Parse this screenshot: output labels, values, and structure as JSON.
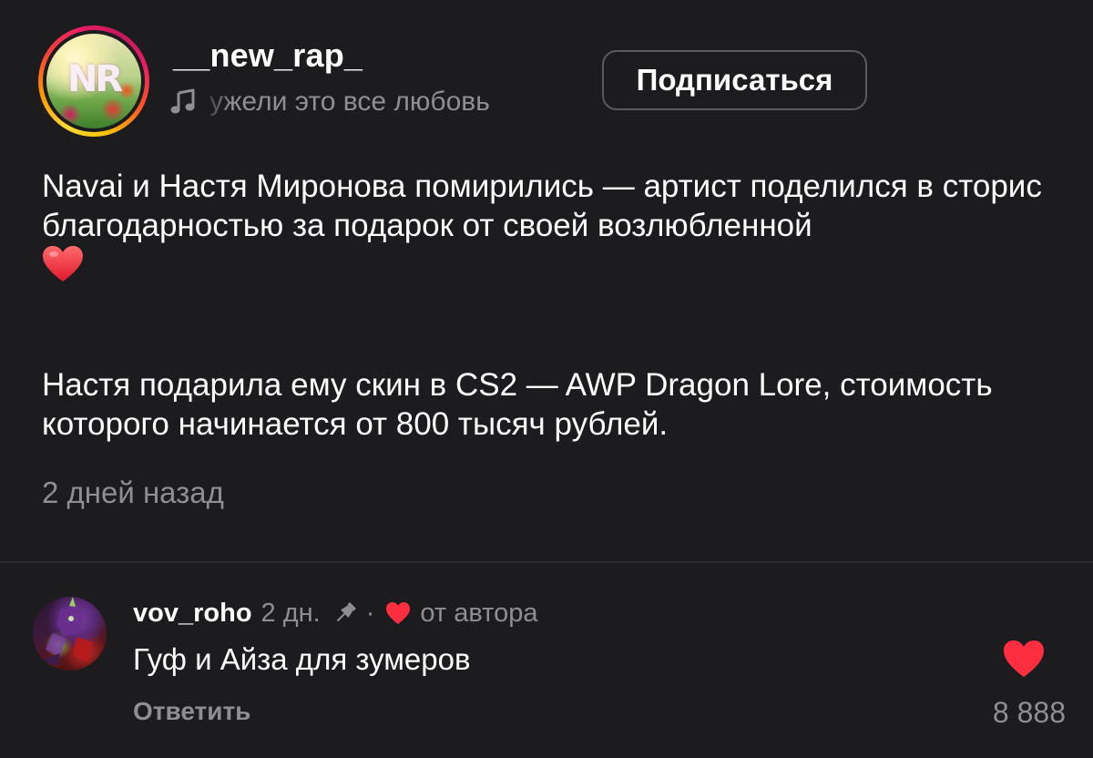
{
  "post": {
    "username": "__new_rap_",
    "avatar_logo": "NR",
    "music_label": "ужели это все любовь",
    "subscribe_label": "Подписаться",
    "text_line_1": "Navai и Настя Миронова помирились — артист поделился в сторис благодарностью за подарок от своей возлюбленной",
    "text_line_2": "Настя подарила ему скин в CS2 — AWP Dragon Lore, стоимость которого начинается от 800 тысяч рублей.",
    "time": "2 дней назад",
    "icons": {
      "music": "music-note-icon",
      "emoji": "red-heart-emoji"
    }
  },
  "comment": {
    "username": "vov_roho",
    "time": "2 дн.",
    "separator": "·",
    "author_label": "от автора",
    "text": "Гуф и Айза для зумеров",
    "reply_label": "Ответить",
    "like_count": "8 888",
    "liked": true,
    "icons": {
      "pin": "pin-icon",
      "author_like": "heart-icon",
      "like": "heart-filled-icon"
    }
  },
  "colors": {
    "background": "#1c1c1e",
    "text_primary": "#ffffff",
    "text_secondary": "#8e8e93",
    "heart": "#ff2d40",
    "divider": "#2c2c2e",
    "button_border": "#5a5a5e"
  }
}
